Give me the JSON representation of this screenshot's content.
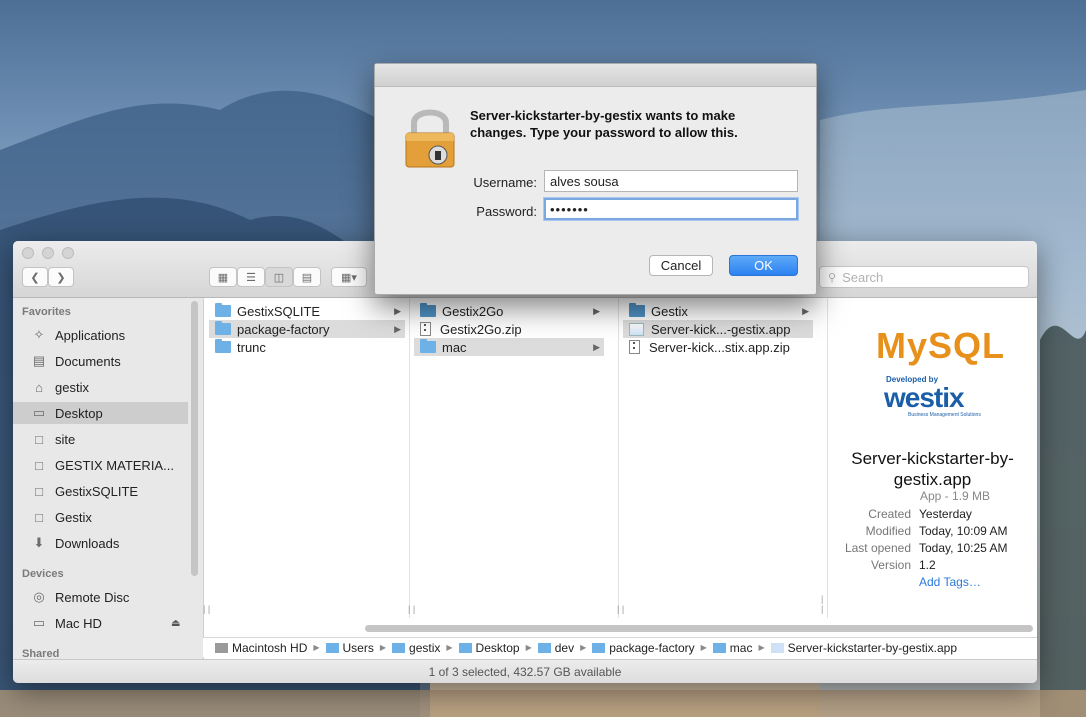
{
  "dialog": {
    "message": "Server-kickstarter-by-gestix wants to make changes. Type your password to allow this.",
    "username_label": "Username:",
    "username_value": "alves sousa",
    "password_label": "Password:",
    "password_value": "•••••••",
    "cancel_label": "Cancel",
    "ok_label": "OK"
  },
  "finder": {
    "search_placeholder": "Search",
    "sidebar": {
      "favorites_header": "Favorites",
      "favorites": [
        {
          "label": "Applications",
          "icon": "applications-icon"
        },
        {
          "label": "Documents",
          "icon": "documents-icon"
        },
        {
          "label": "gestix",
          "icon": "home-icon"
        },
        {
          "label": "Desktop",
          "icon": "desktop-icon",
          "selected": true
        },
        {
          "label": "site",
          "icon": "folder-icon"
        },
        {
          "label": "GESTIX MATERIA...",
          "icon": "folder-icon"
        },
        {
          "label": "GestixSQLITE",
          "icon": "folder-icon"
        },
        {
          "label": "Gestix",
          "icon": "folder-icon"
        },
        {
          "label": "Downloads",
          "icon": "downloads-icon"
        }
      ],
      "devices_header": "Devices",
      "devices": [
        {
          "label": "Remote Disc",
          "icon": "disc-icon"
        },
        {
          "label": "Mac HD",
          "icon": "harddisk-icon"
        }
      ],
      "shared_header": "Shared"
    },
    "columns": [
      [
        {
          "label": "GestixSQLITE",
          "type": "folder",
          "chevron": true
        },
        {
          "label": "package-factory",
          "type": "folder",
          "chevron": true,
          "selected": true
        },
        {
          "label": "trunc",
          "type": "folder"
        }
      ],
      [
        {
          "label": "Gestix2Go",
          "type": "folder-dark",
          "chevron": true
        },
        {
          "label": "Gestix2Go.zip",
          "type": "zip"
        },
        {
          "label": "mac",
          "type": "folder",
          "chevron": true,
          "selected": true
        }
      ],
      [
        {
          "label": "Gestix",
          "type": "folder-dark",
          "chevron": true
        },
        {
          "label": "Server-kick...-gestix.app",
          "type": "app",
          "selected": true
        },
        {
          "label": "Server-kick...stix.app.zip",
          "type": "zip"
        }
      ]
    ],
    "preview": {
      "logo_text": "MySQL",
      "developed_by": "Developed by",
      "brand": "westix",
      "tagline": "Business Management Solutions",
      "name": "Server-kickstarter-by-gestix.app",
      "kind": "App - 1.9 MB",
      "meta": [
        {
          "key": "Created",
          "value": "Yesterday"
        },
        {
          "key": "Modified",
          "value": "Today, 10:09 AM"
        },
        {
          "key": "Last opened",
          "value": "Today, 10:25 AM"
        },
        {
          "key": "Version",
          "value": "1.2"
        }
      ],
      "add_tags": "Add Tags…"
    },
    "path": [
      "Macintosh HD",
      "Users",
      "gestix",
      "Desktop",
      "dev",
      "package-factory",
      "mac",
      "Server-kickstarter-by-gestix.app"
    ],
    "status": "1 of 3 selected, 432.57 GB available"
  },
  "colors": {
    "accent": "#2b82f0",
    "selection": "#cdcdcd",
    "mysql_orange": "#e8901c",
    "gestix_blue": "#1b5ea8",
    "tag_link": "#2a7ad8"
  }
}
